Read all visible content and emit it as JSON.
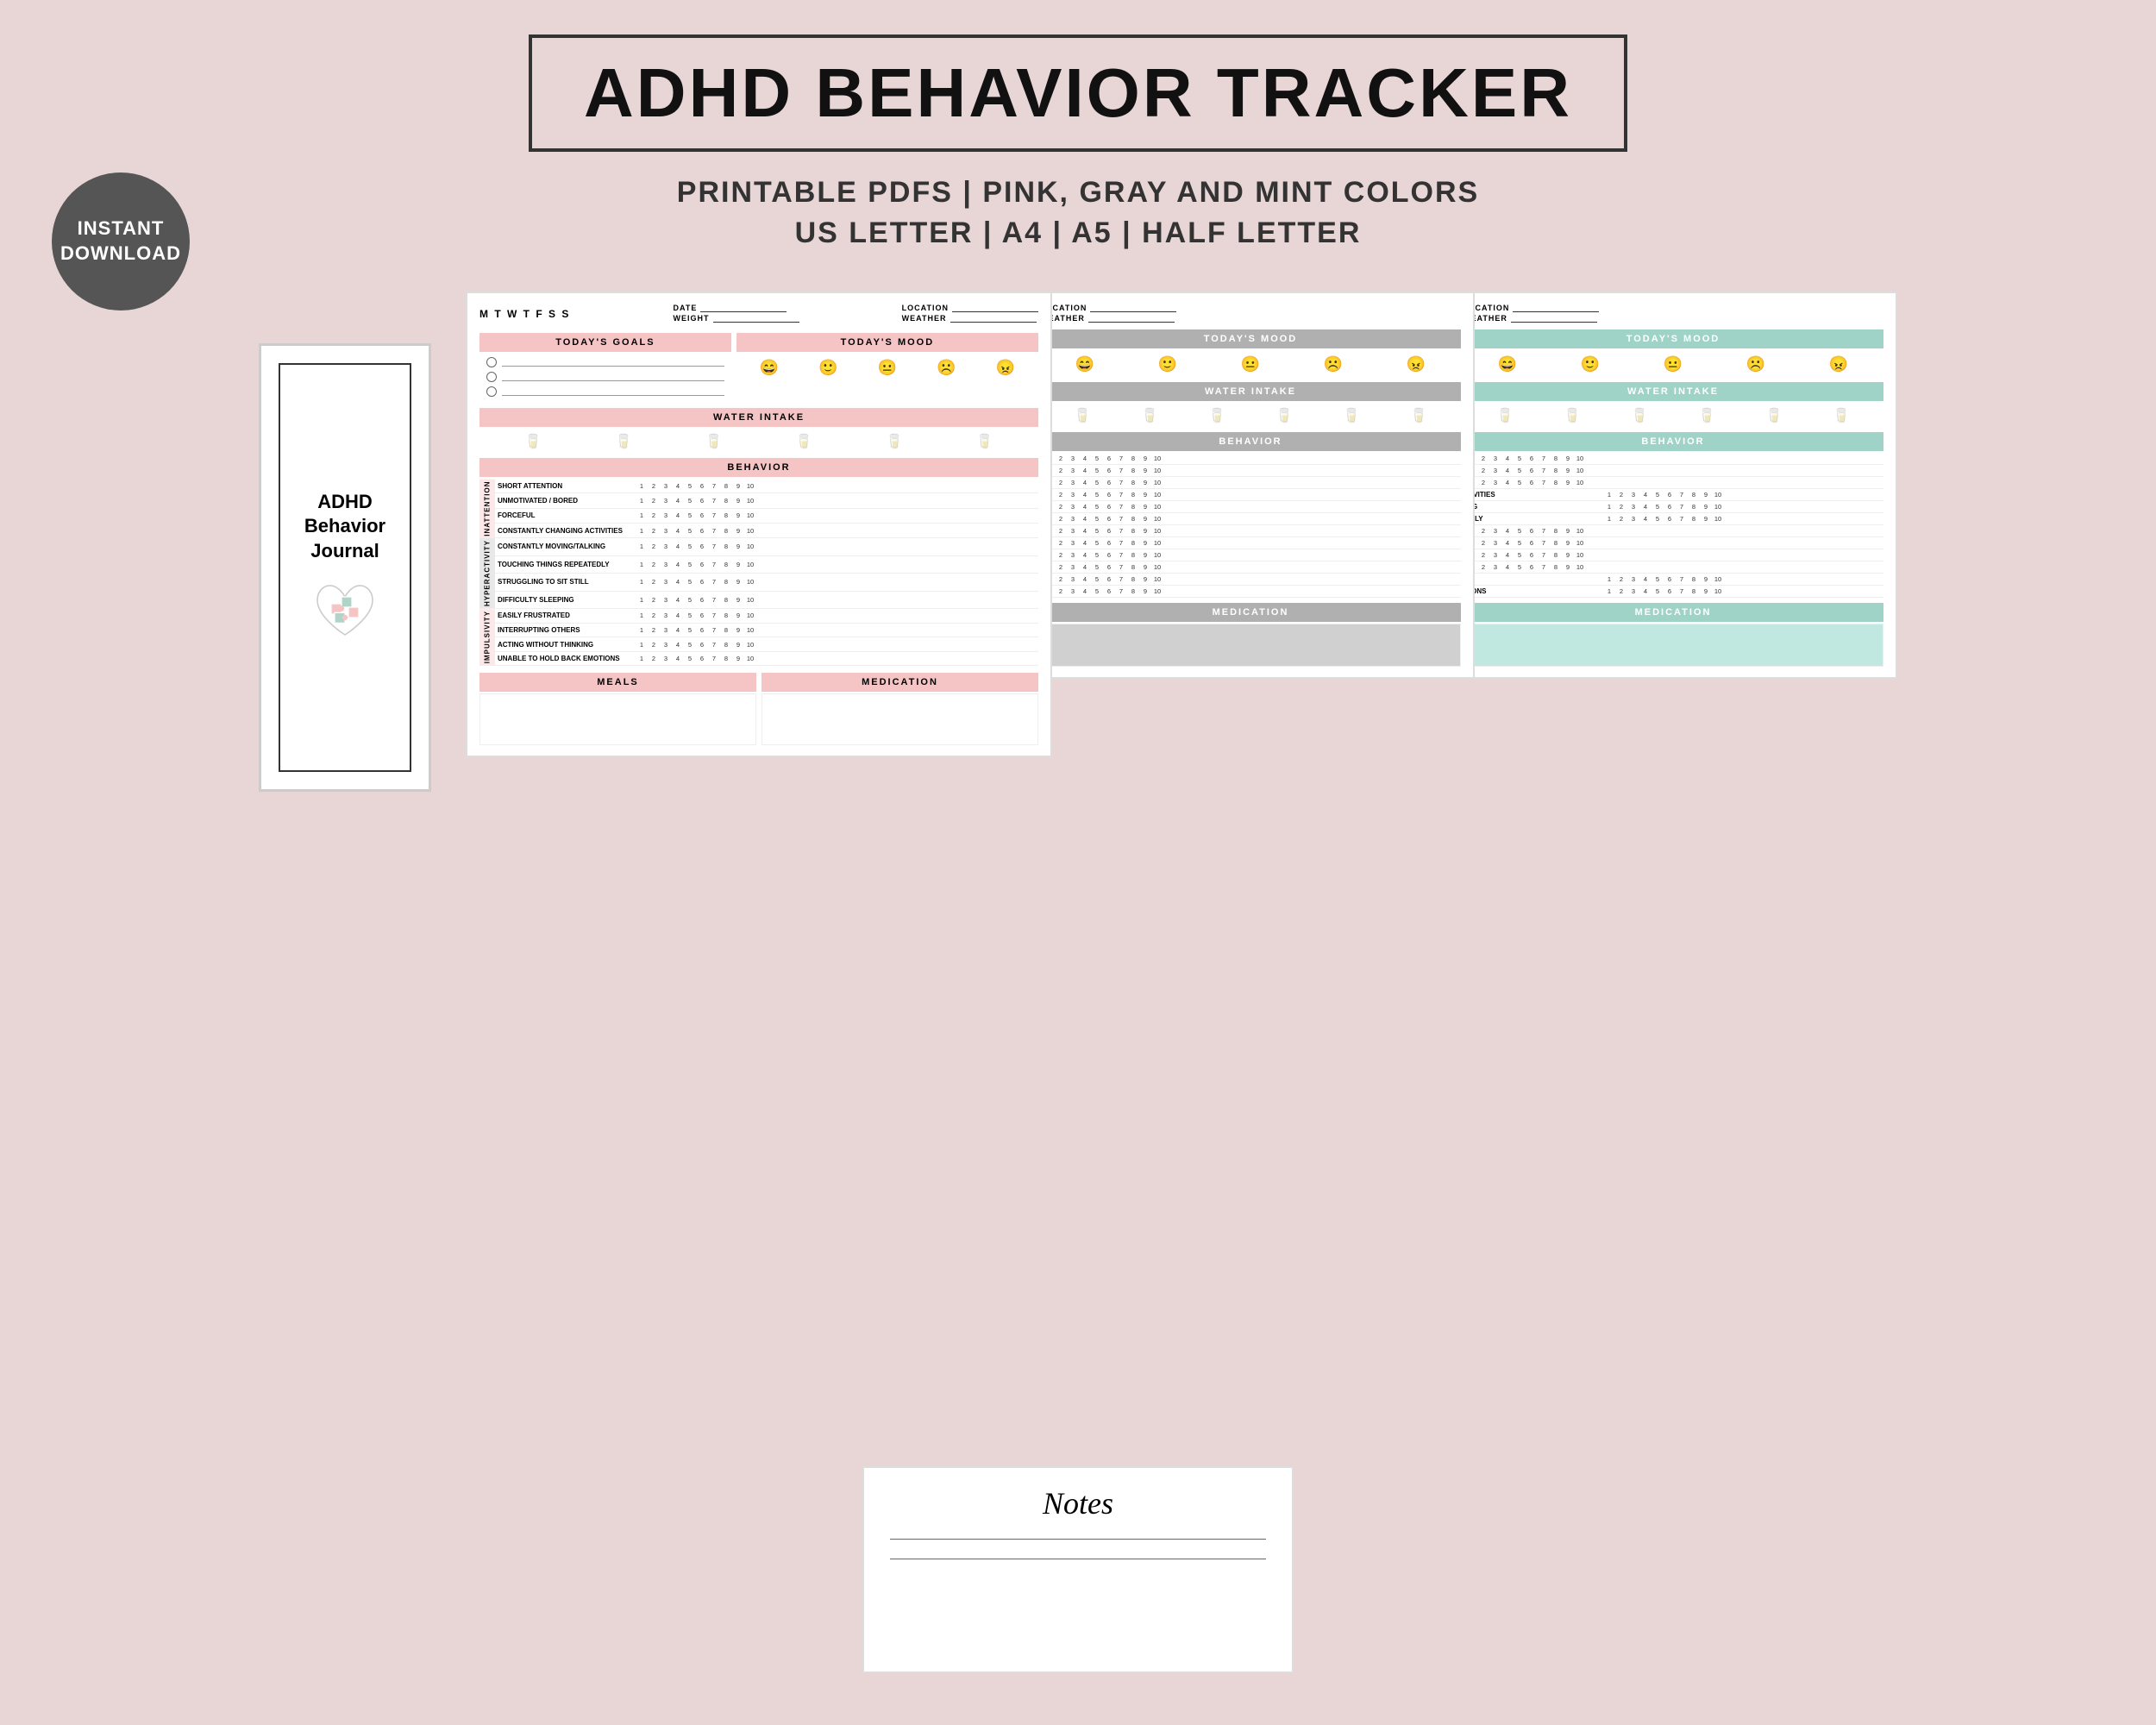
{
  "header": {
    "title": "ADHD BEHAVIOR TRACKER",
    "subtitle1": "PRINTABLE PDFS  |  PINK, GRAY AND MINT COLORS",
    "subtitle2": "US LETTER  |  A4  |  A5  |  HALF LETTER"
  },
  "badge": {
    "line1": "INSTANT",
    "line2": "DOWNLOAD"
  },
  "journal": {
    "title": "ADHD\nBehavior\nJournal"
  },
  "tracker": {
    "days": "M  T  W  T  F  S  S",
    "date_label": "DATE",
    "weight_label": "WEIGHT",
    "location_label": "LOCATION",
    "weather_label": "WEATHER",
    "goals_header": "TODAY'S GOALS",
    "mood_header": "TODAY'S MOOD",
    "water_header": "WATER INTAKE",
    "behavior_header": "BEHAVIOR",
    "meals_header": "MEALS",
    "medication_header": "MEDICATION",
    "sections": {
      "inattention": "INATTENTION",
      "hyperactivity": "HYPERACTIVITY",
      "impulsivity": "IMPULSIVITY"
    },
    "behaviors": {
      "inattention": [
        "SHORT ATTENTION",
        "UNMOTIVATED / BORED",
        "FORCEFUL",
        "CONSTANTLY CHANGING ACTIVITIES"
      ],
      "hyperactivity": [
        "CONSTANTLY MOVING/TALKING",
        "TOUCHING THINGS REPEATEDLY",
        "STRUGGLING TO SIT STILL",
        "DIFFICULTY SLEEPING"
      ],
      "impulsivity": [
        "EASILY FRUSTRATED",
        "INTERRUPTING OTHERS",
        "ACTING WITHOUT THINKING",
        "UNABLE TO HOLD BACK EMOTIONS"
      ]
    },
    "scale": "1  2  3  4  5  6  7  8  9  10"
  },
  "notes": {
    "title": "Notes"
  }
}
